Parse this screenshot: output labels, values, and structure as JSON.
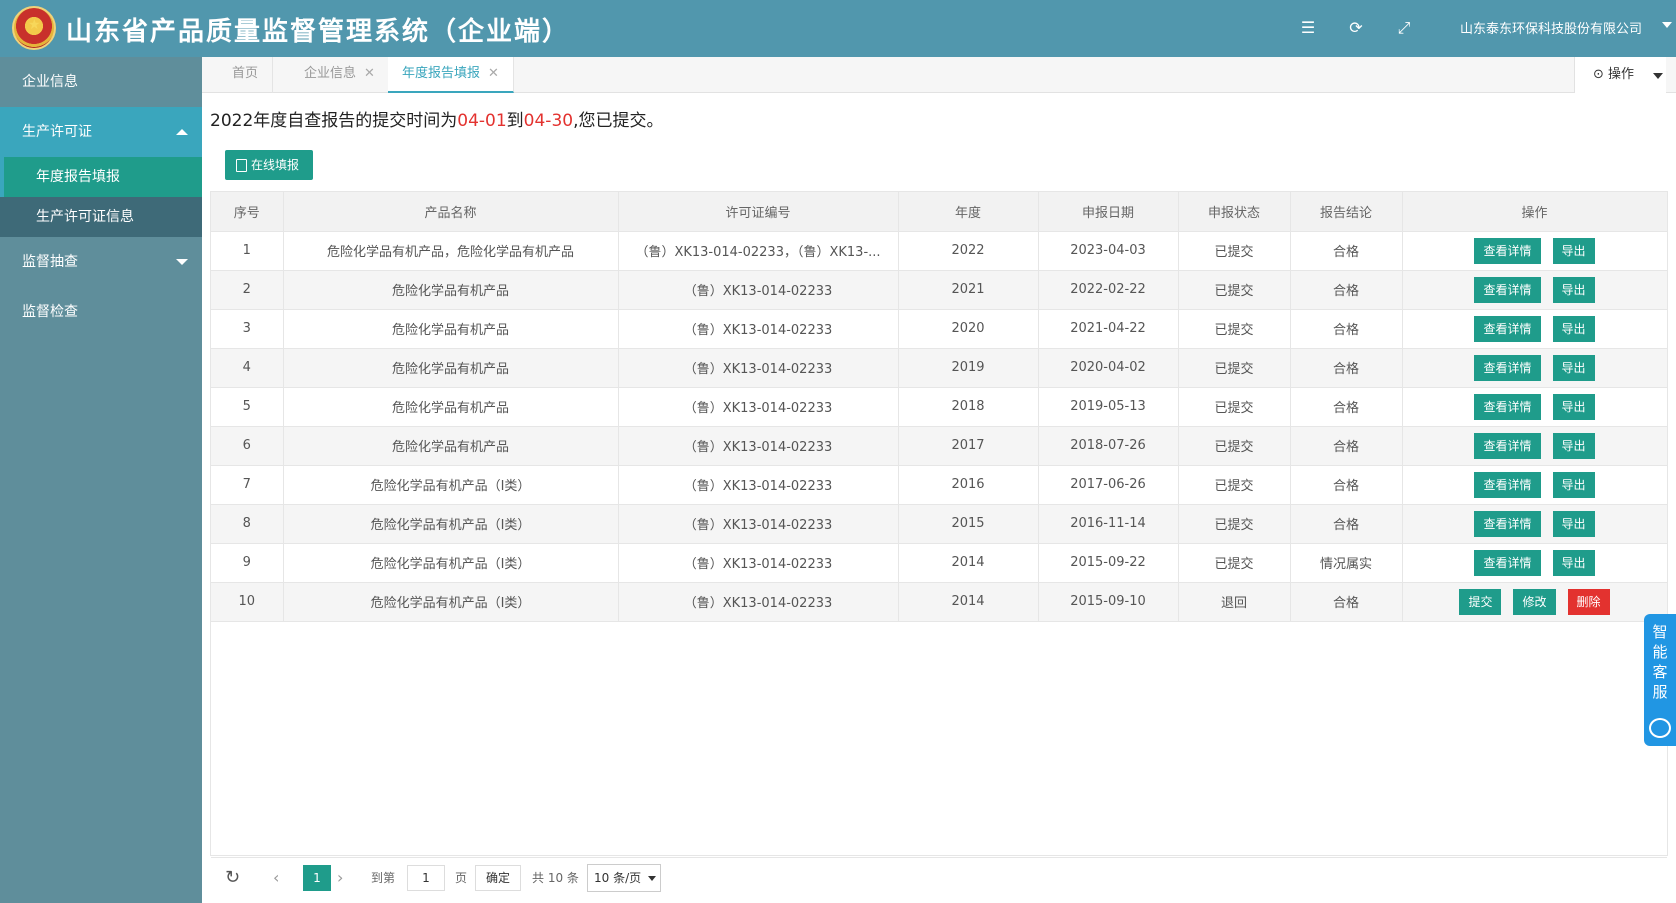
{
  "header": {
    "title": "山东省产品质量监督管理系统（企业端）",
    "company": "山东泰东环保科技股份有限公司"
  },
  "sidebar": {
    "items": [
      {
        "label": "企业信息"
      },
      {
        "label": "生产许可证"
      },
      {
        "label": "年度报告填报"
      },
      {
        "label": "生产许可证信息"
      },
      {
        "label": "监督抽查"
      },
      {
        "label": "监督检查"
      }
    ]
  },
  "tabs": [
    {
      "label": "首页"
    },
    {
      "label": "企业信息"
    },
    {
      "label": "年度报告填报"
    }
  ],
  "ops_label": "操作",
  "notice": {
    "prefix": "2022年度自查报告的提交时间为",
    "start": "04-01",
    "mid": "到",
    "end": "04-30",
    "suffix": ",您已提交。"
  },
  "fill_button": "在线填报",
  "table": {
    "headers": [
      "序号",
      "产品名称",
      "许可证编号",
      "年度",
      "申报日期",
      "申报状态",
      "报告结论",
      "操作"
    ],
    "rows": [
      {
        "no": "1",
        "product": "危险化学品有机产品，危险化学品有机产品",
        "license": "（鲁）XK13-014-02233，（鲁）XK13-...",
        "year": "2022",
        "date": "2023-04-03",
        "status": "已提交",
        "conclusion": "合格"
      },
      {
        "no": "2",
        "product": "危险化学品有机产品",
        "license": "（鲁）XK13-014-02233",
        "year": "2021",
        "date": "2022-02-22",
        "status": "已提交",
        "conclusion": "合格"
      },
      {
        "no": "3",
        "product": "危险化学品有机产品",
        "license": "（鲁）XK13-014-02233",
        "year": "2020",
        "date": "2021-04-22",
        "status": "已提交",
        "conclusion": "合格"
      },
      {
        "no": "4",
        "product": "危险化学品有机产品",
        "license": "（鲁）XK13-014-02233",
        "year": "2019",
        "date": "2020-04-02",
        "status": "已提交",
        "conclusion": "合格"
      },
      {
        "no": "5",
        "product": "危险化学品有机产品",
        "license": "（鲁）XK13-014-02233",
        "year": "2018",
        "date": "2019-05-13",
        "status": "已提交",
        "conclusion": "合格"
      },
      {
        "no": "6",
        "product": "危险化学品有机产品",
        "license": "（鲁）XK13-014-02233",
        "year": "2017",
        "date": "2018-07-26",
        "status": "已提交",
        "conclusion": "合格"
      },
      {
        "no": "7",
        "product": "危险化学品有机产品（I类）",
        "license": "（鲁）XK13-014-02233",
        "year": "2016",
        "date": "2017-06-26",
        "status": "已提交",
        "conclusion": "合格"
      },
      {
        "no": "8",
        "product": "危险化学品有机产品（I类）",
        "license": "（鲁）XK13-014-02233",
        "year": "2015",
        "date": "2016-11-14",
        "status": "已提交",
        "conclusion": "合格"
      },
      {
        "no": "9",
        "product": "危险化学品有机产品（I类）",
        "license": "（鲁）XK13-014-02233",
        "year": "2014",
        "date": "2015-09-22",
        "status": "已提交",
        "conclusion": "情况属实"
      },
      {
        "no": "10",
        "product": "危险化学品有机产品（I类）",
        "license": "（鲁）XK13-014-02233",
        "year": "2014",
        "date": "2015-09-10",
        "status": "退回",
        "conclusion": "合格"
      }
    ],
    "actions": {
      "detail": "查看详情",
      "export": "导出",
      "submit": "提交",
      "modify": "修改",
      "delete": "删除"
    }
  },
  "pager": {
    "current": "1",
    "goto_prefix": "到第",
    "goto_value": "1",
    "page_suffix": "页",
    "confirm": "确定",
    "total": "共 10 条",
    "page_size": "10 条/页"
  },
  "service": {
    "label": "智能客服"
  }
}
